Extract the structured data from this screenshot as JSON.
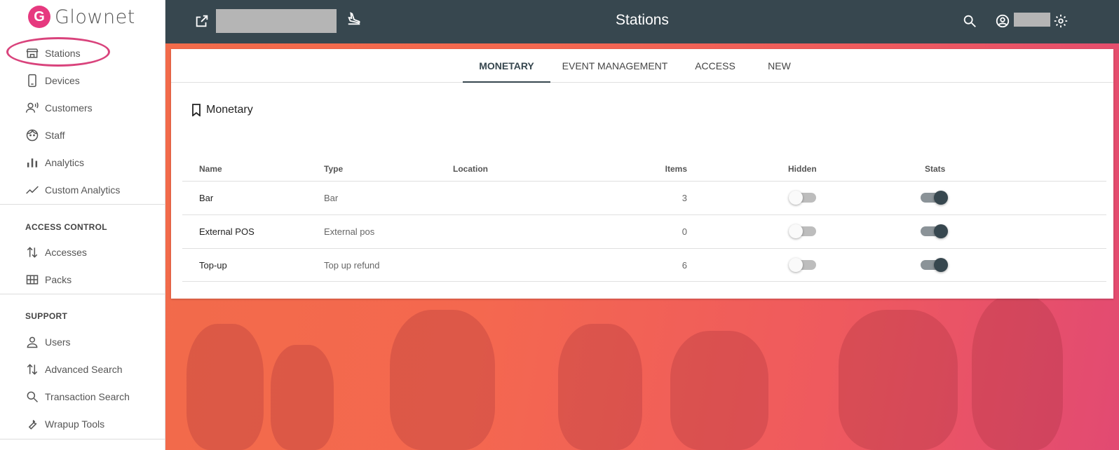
{
  "app": {
    "name": "Glownet",
    "logo_letter": "G",
    "brand_color": "#e6397f"
  },
  "sidebar": {
    "main_items": [
      {
        "label": "Stations",
        "icon": "store-icon"
      },
      {
        "label": "Devices",
        "icon": "phone-icon"
      },
      {
        "label": "Customers",
        "icon": "customers-icon"
      },
      {
        "label": "Staff",
        "icon": "face-icon"
      },
      {
        "label": "Analytics",
        "icon": "bar-chart-icon"
      },
      {
        "label": "Custom Analytics",
        "icon": "trending-icon"
      }
    ],
    "access_control": {
      "title": "ACCESS CONTROL",
      "items": [
        {
          "label": "Accesses",
          "icon": "swap-vert-icon"
        },
        {
          "label": "Packs",
          "icon": "grid-icon"
        }
      ]
    },
    "support": {
      "title": "SUPPORT",
      "items": [
        {
          "label": "Users",
          "icon": "person-icon"
        },
        {
          "label": "Advanced Search",
          "icon": "swap-vert-icon"
        },
        {
          "label": "Transaction Search",
          "icon": "search-icon"
        },
        {
          "label": "Wrapup Tools",
          "icon": "wrench-icon"
        }
      ]
    }
  },
  "header": {
    "title": "Stations",
    "color": "#37474f"
  },
  "tabs": [
    {
      "label": "MONETARY",
      "active": true
    },
    {
      "label": "EVENT MANAGEMENT",
      "active": false
    },
    {
      "label": "ACCESS",
      "active": false
    },
    {
      "label": "NEW",
      "active": false
    }
  ],
  "section": {
    "title": "Monetary"
  },
  "table": {
    "columns": [
      "Name",
      "Type",
      "Location",
      "Items",
      "Hidden",
      "Stats"
    ],
    "rows": [
      {
        "name": "Bar",
        "type": "Bar",
        "location": "",
        "items": "3",
        "hidden": false,
        "stats": true
      },
      {
        "name": "External POS",
        "type": "External pos",
        "location": "",
        "items": "0",
        "hidden": false,
        "stats": true
      },
      {
        "name": "Top-up",
        "type": "Top up refund",
        "location": "",
        "items": "6",
        "hidden": false,
        "stats": true
      }
    ]
  }
}
